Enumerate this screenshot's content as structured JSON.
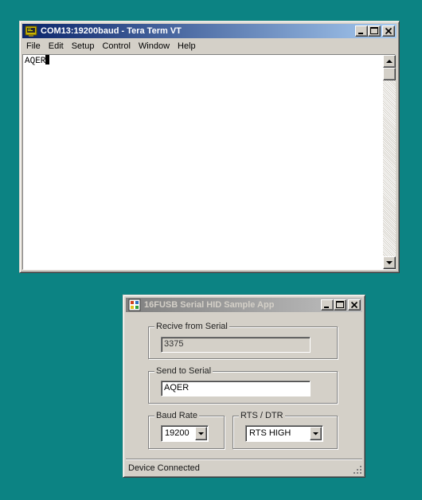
{
  "teraterm": {
    "title": "COM13:19200baud - Tera Term VT",
    "menu": [
      "File",
      "Edit",
      "Setup",
      "Control",
      "Window",
      "Help"
    ],
    "terminal_text": "AQER",
    "icon": "teraterm-app-icon"
  },
  "hid_app": {
    "title": "16FUSB Serial HID Sample App",
    "icon": "hid-app-icon",
    "receive": {
      "label": "Recive from Serial",
      "value": "3375"
    },
    "send": {
      "label": "Send to Serial",
      "value": "AQER"
    },
    "baud": {
      "label": "Baud Rate",
      "value": "19200"
    },
    "rts": {
      "label": "RTS / DTR",
      "value": "RTS HIGH"
    },
    "status": "Device Connected"
  },
  "colors": {
    "desktop": "#0c8383",
    "active_title": "#0a246a",
    "inactive_title": "#808080",
    "window_face": "#d4d0c8"
  }
}
